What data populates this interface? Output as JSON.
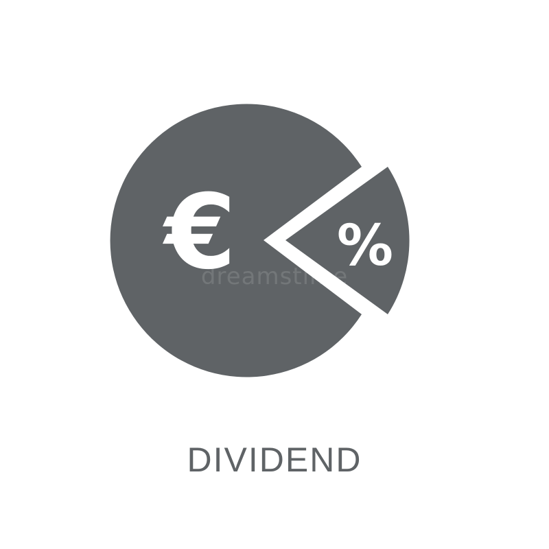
{
  "icon": {
    "name": "dividend-pie-icon",
    "currency_symbol": "€",
    "percent_symbol": "%",
    "fill_color": "#5f6366",
    "glyph_color": "#ffffff"
  },
  "caption": "DIVIDEND",
  "watermark": "dreamstime"
}
